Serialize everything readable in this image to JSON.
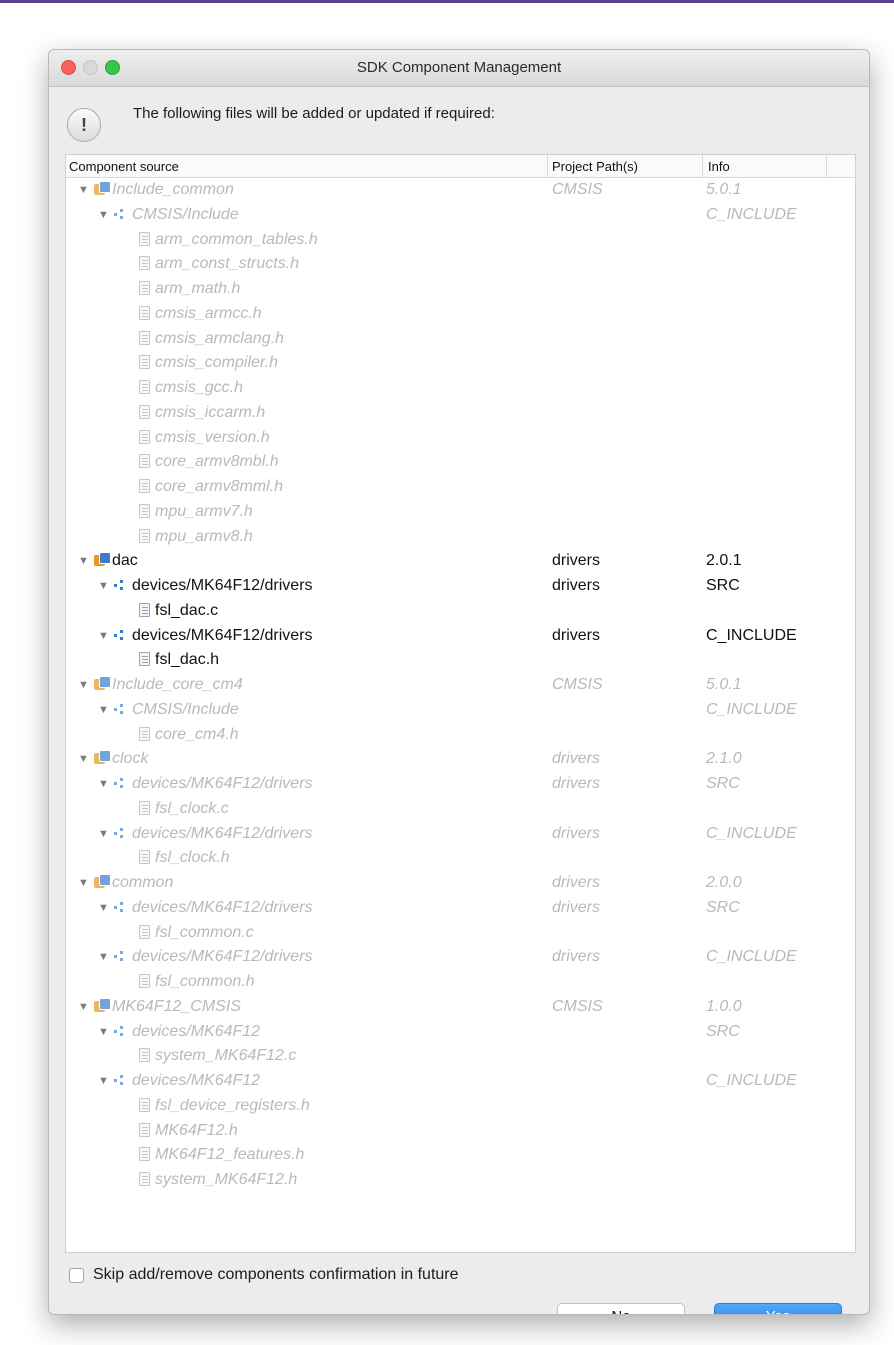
{
  "window": {
    "title": "SDK Component Management"
  },
  "message": "The following files will be added or updated if required:",
  "columns": [
    "Component source",
    "Project Path(s)",
    "Info"
  ],
  "rows": [
    {
      "level": 0,
      "type": "component",
      "label": "Include_common",
      "path": "CMSIS",
      "info": "5.0.1",
      "enabled": false
    },
    {
      "level": 1,
      "type": "folder",
      "label": "CMSIS/Include",
      "path": "",
      "info": "C_INCLUDE",
      "enabled": false
    },
    {
      "level": 2,
      "type": "file",
      "label": "arm_common_tables.h",
      "path": "",
      "info": "",
      "enabled": false
    },
    {
      "level": 2,
      "type": "file",
      "label": "arm_const_structs.h",
      "path": "",
      "info": "",
      "enabled": false
    },
    {
      "level": 2,
      "type": "file",
      "label": "arm_math.h",
      "path": "",
      "info": "",
      "enabled": false
    },
    {
      "level": 2,
      "type": "file",
      "label": "cmsis_armcc.h",
      "path": "",
      "info": "",
      "enabled": false
    },
    {
      "level": 2,
      "type": "file",
      "label": "cmsis_armclang.h",
      "path": "",
      "info": "",
      "enabled": false
    },
    {
      "level": 2,
      "type": "file",
      "label": "cmsis_compiler.h",
      "path": "",
      "info": "",
      "enabled": false
    },
    {
      "level": 2,
      "type": "file",
      "label": "cmsis_gcc.h",
      "path": "",
      "info": "",
      "enabled": false
    },
    {
      "level": 2,
      "type": "file",
      "label": "cmsis_iccarm.h",
      "path": "",
      "info": "",
      "enabled": false
    },
    {
      "level": 2,
      "type": "file",
      "label": "cmsis_version.h",
      "path": "",
      "info": "",
      "enabled": false
    },
    {
      "level": 2,
      "type": "file",
      "label": "core_armv8mbl.h",
      "path": "",
      "info": "",
      "enabled": false
    },
    {
      "level": 2,
      "type": "file",
      "label": "core_armv8mml.h",
      "path": "",
      "info": "",
      "enabled": false
    },
    {
      "level": 2,
      "type": "file",
      "label": "mpu_armv7.h",
      "path": "",
      "info": "",
      "enabled": false
    },
    {
      "level": 2,
      "type": "file",
      "label": "mpu_armv8.h",
      "path": "",
      "info": "",
      "enabled": false
    },
    {
      "level": 0,
      "type": "component",
      "label": "dac",
      "path": "drivers",
      "info": "2.0.1",
      "enabled": true
    },
    {
      "level": 1,
      "type": "folder",
      "label": "devices/MK64F12/drivers",
      "path": "drivers",
      "info": "SRC",
      "enabled": true
    },
    {
      "level": 2,
      "type": "file",
      "label": "fsl_dac.c",
      "path": "",
      "info": "",
      "enabled": true
    },
    {
      "level": 1,
      "type": "folder",
      "label": "devices/MK64F12/drivers",
      "path": "drivers",
      "info": "C_INCLUDE",
      "enabled": true
    },
    {
      "level": 2,
      "type": "file",
      "label": "fsl_dac.h",
      "path": "",
      "info": "",
      "enabled": true
    },
    {
      "level": 0,
      "type": "component",
      "label": "Include_core_cm4",
      "path": "CMSIS",
      "info": "5.0.1",
      "enabled": false
    },
    {
      "level": 1,
      "type": "folder",
      "label": "CMSIS/Include",
      "path": "",
      "info": "C_INCLUDE",
      "enabled": false
    },
    {
      "level": 2,
      "type": "file",
      "label": "core_cm4.h",
      "path": "",
      "info": "",
      "enabled": false
    },
    {
      "level": 0,
      "type": "component",
      "label": "clock",
      "path": "drivers",
      "info": "2.1.0",
      "enabled": false
    },
    {
      "level": 1,
      "type": "folder",
      "label": "devices/MK64F12/drivers",
      "path": "drivers",
      "info": "SRC",
      "enabled": false
    },
    {
      "level": 2,
      "type": "file",
      "label": "fsl_clock.c",
      "path": "",
      "info": "",
      "enabled": false
    },
    {
      "level": 1,
      "type": "folder",
      "label": "devices/MK64F12/drivers",
      "path": "drivers",
      "info": "C_INCLUDE",
      "enabled": false
    },
    {
      "level": 2,
      "type": "file",
      "label": "fsl_clock.h",
      "path": "",
      "info": "",
      "enabled": false
    },
    {
      "level": 0,
      "type": "component",
      "label": "common",
      "path": "drivers",
      "info": "2.0.0",
      "enabled": false
    },
    {
      "level": 1,
      "type": "folder",
      "label": "devices/MK64F12/drivers",
      "path": "drivers",
      "info": "SRC",
      "enabled": false
    },
    {
      "level": 2,
      "type": "file",
      "label": "fsl_common.c",
      "path": "",
      "info": "",
      "enabled": false
    },
    {
      "level": 1,
      "type": "folder",
      "label": "devices/MK64F12/drivers",
      "path": "drivers",
      "info": "C_INCLUDE",
      "enabled": false
    },
    {
      "level": 2,
      "type": "file",
      "label": "fsl_common.h",
      "path": "",
      "info": "",
      "enabled": false
    },
    {
      "level": 0,
      "type": "component",
      "label": "MK64F12_CMSIS",
      "path": "CMSIS",
      "info": "1.0.0",
      "enabled": false
    },
    {
      "level": 1,
      "type": "folder",
      "label": "devices/MK64F12",
      "path": "",
      "info": "SRC",
      "enabled": false
    },
    {
      "level": 2,
      "type": "file",
      "label": "system_MK64F12.c",
      "path": "",
      "info": "",
      "enabled": false
    },
    {
      "level": 1,
      "type": "folder",
      "label": "devices/MK64F12",
      "path": "",
      "info": "C_INCLUDE",
      "enabled": false
    },
    {
      "level": 2,
      "type": "file",
      "label": "fsl_device_registers.h",
      "path": "",
      "info": "",
      "enabled": false
    },
    {
      "level": 2,
      "type": "file",
      "label": "MK64F12.h",
      "path": "",
      "info": "",
      "enabled": false
    },
    {
      "level": 2,
      "type": "file",
      "label": "MK64F12_features.h",
      "path": "",
      "info": "",
      "enabled": false
    },
    {
      "level": 2,
      "type": "file",
      "label": "system_MK64F12.h",
      "path": "",
      "info": "",
      "enabled": false
    }
  ],
  "skip_checkbox": {
    "label": "Skip add/remove components confirmation in future",
    "checked": false
  },
  "buttons": {
    "no": "No",
    "yes": "Yes"
  },
  "colors": {
    "accent": "#2a83ee",
    "disabled_text": "#b9b9b9",
    "titlebar_rule": "#5b3f8c"
  },
  "icons": {
    "component": "component-icon",
    "folder": "folder-icon",
    "file": "file-icon",
    "expand": "triangle-down-icon",
    "alert": "exclamation-icon"
  }
}
